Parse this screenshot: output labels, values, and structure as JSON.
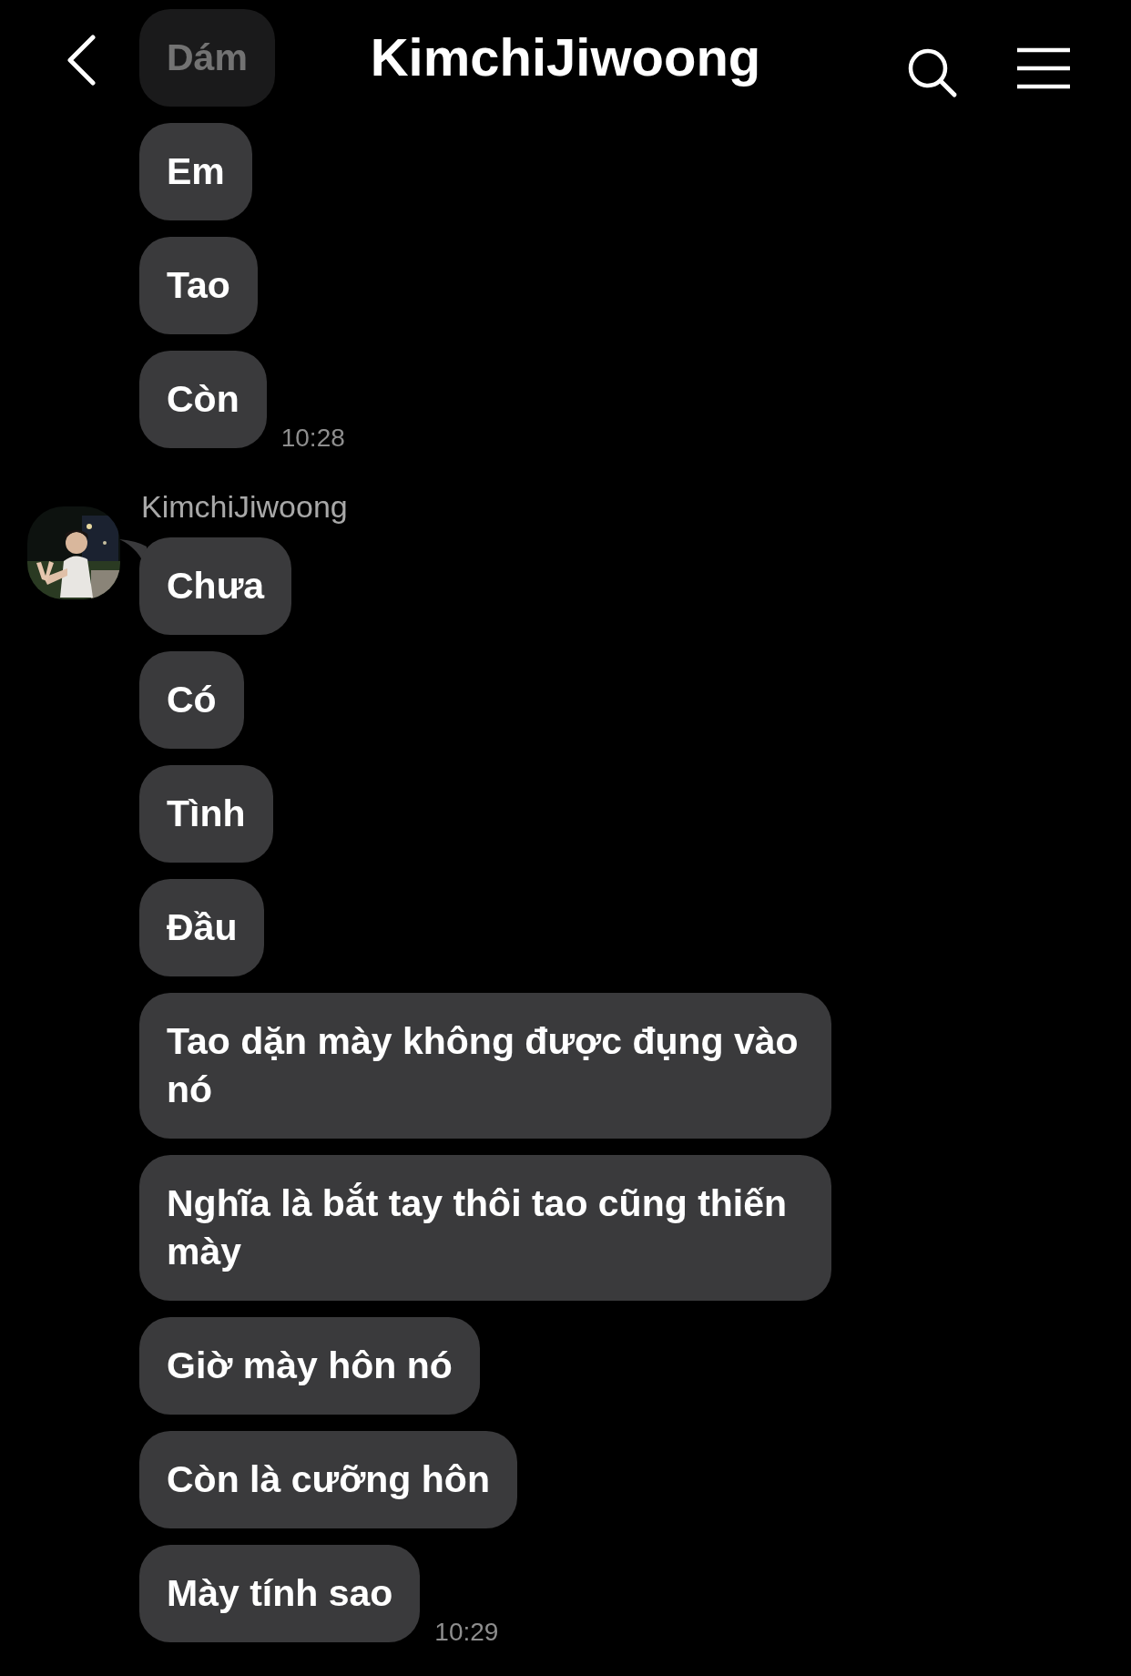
{
  "header": {
    "title": "KimchiJiwoong"
  },
  "groups": [
    {
      "messages": [
        "Dám",
        "Em",
        "Tao",
        "Còn"
      ],
      "time": "10:28"
    },
    {
      "sender": "KimchiJiwoong",
      "messages": [
        "Chưa",
        "Có",
        "Tình",
        "Đầu",
        "Tao dặn mày không được đụng vào nó",
        "Nghĩa là bắt tay thôi tao cũng thiến mày",
        "Giờ mày hôn nó",
        "Còn là cưỡng hôn",
        "Mày tính sao"
      ],
      "time": "10:29"
    }
  ]
}
